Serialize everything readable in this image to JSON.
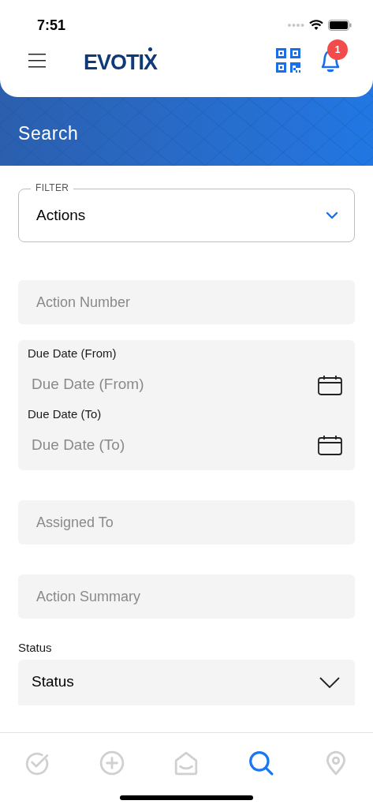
{
  "status_bar": {
    "time": "7:51"
  },
  "header": {
    "logo": "EVOTIX",
    "notification_count": "1"
  },
  "banner": {
    "title": "Search"
  },
  "filter": {
    "legend": "FILTER",
    "value": "Actions"
  },
  "fields": [
    {
      "kind": "input",
      "placeholder": "Action Number"
    },
    {
      "kind": "date_group",
      "dates": [
        {
          "label": "Due Date (From)",
          "placeholder": "Due Date (From)"
        },
        {
          "label": "Due Date (To)",
          "placeholder": "Due Date (To)"
        }
      ]
    },
    {
      "kind": "input",
      "placeholder": "Assigned To"
    },
    {
      "kind": "input",
      "placeholder": "Action Summary"
    },
    {
      "kind": "select",
      "label": "Status",
      "value": "Status"
    }
  ],
  "tabs": [
    {
      "kind": "tasks",
      "selected": false
    },
    {
      "kind": "add",
      "selected": false
    },
    {
      "kind": "home",
      "selected": false
    },
    {
      "kind": "search",
      "selected": true
    },
    {
      "kind": "location",
      "selected": false
    }
  ]
}
